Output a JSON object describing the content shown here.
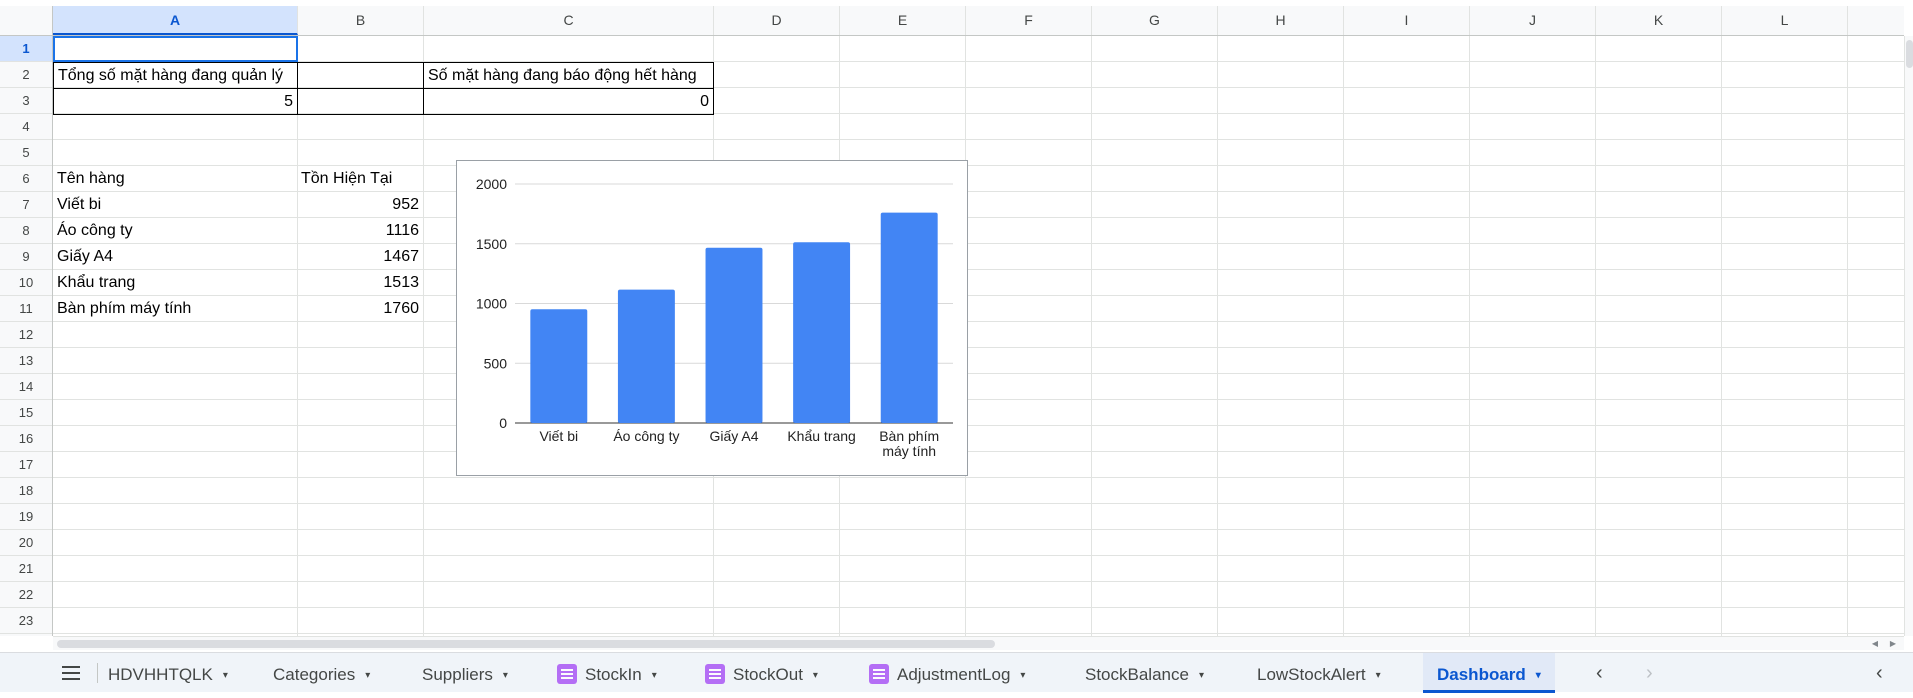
{
  "columns": [
    "A",
    "B",
    "C",
    "D",
    "E",
    "F",
    "G",
    "H",
    "I",
    "J",
    "K",
    "L"
  ],
  "rows": [
    "1",
    "2",
    "3",
    "4",
    "5",
    "6",
    "7",
    "8",
    "9",
    "10",
    "11",
    "12",
    "13",
    "14",
    "15",
    "16",
    "17",
    "18",
    "19",
    "20",
    "21",
    "22",
    "23"
  ],
  "summary": {
    "label_total": "Tổng số mặt hàng đang quản lý",
    "label_alert": "Số mặt hàng đang báo động hết hàng",
    "value_total": "5",
    "value_alert": "0"
  },
  "table": {
    "header_name": "Tên hàng",
    "header_stock": "Tồn Hiện Tại",
    "rows": [
      {
        "name": "Viết bi",
        "stock": "952"
      },
      {
        "name": "Áo công ty",
        "stock": "1116"
      },
      {
        "name": "Giấy A4",
        "stock": "1467"
      },
      {
        "name": "Khẩu trang",
        "stock": "1513"
      },
      {
        "name": "Bàn phím máy tính",
        "stock": "1760"
      }
    ]
  },
  "chart_data": {
    "type": "bar",
    "categories": [
      "Viết bi",
      "Áo công ty",
      "Giấy A4",
      "Khẩu trang",
      "Bàn phím máy tính"
    ],
    "values": [
      952,
      1116,
      1467,
      1513,
      1760
    ],
    "ylim": [
      0,
      2000
    ],
    "yticks": [
      0,
      500,
      1000,
      1500,
      2000
    ],
    "grid": true,
    "bar_color": "#4285f4"
  },
  "tabs": [
    {
      "label": "HDVHHTQLK",
      "icon": false
    },
    {
      "label": "Categories",
      "icon": false
    },
    {
      "label": "Suppliers",
      "icon": false
    },
    {
      "label": "StockIn",
      "icon": true
    },
    {
      "label": "StockOut",
      "icon": true
    },
    {
      "label": "AdjustmentLog",
      "icon": true
    },
    {
      "label": "StockBalance",
      "icon": false
    },
    {
      "label": "LowStockAlert",
      "icon": false
    },
    {
      "label": "Dashboard",
      "icon": false,
      "active": true
    }
  ],
  "icons": {
    "menu": "all-sheets-menu-icon",
    "caret": "▾",
    "nav_prev": "‹",
    "nav_next": "›",
    "collapse": "‹"
  },
  "colors": {
    "accent": "#0b57d0",
    "selection": "#1a73e8",
    "header_bg": "#f8f9fa"
  }
}
